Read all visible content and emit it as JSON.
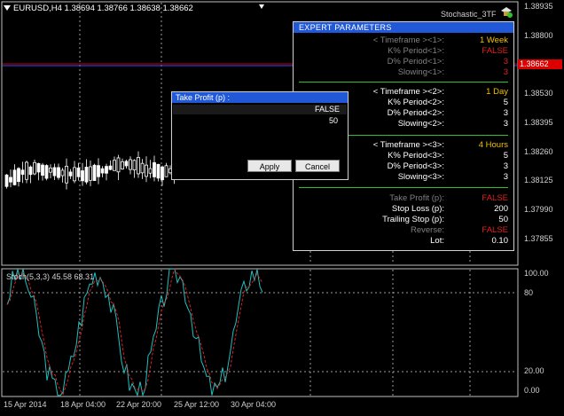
{
  "chart": {
    "symbol_info": "EURUSD,H4  1.38694 1.38766 1.38638 1.38662",
    "indicator_name": "Stochastic_3TF",
    "price_axis": [
      "1.38935",
      "1.38800",
      "1.38662",
      "1.38530",
      "1.38395",
      "1.38260",
      "1.38125",
      "1.37990",
      "1.37855"
    ],
    "current_price": "1.38662",
    "stoch_label": "Stoch(5,3,3) 45.58 68.31",
    "stoch_axis": [
      "100.00",
      "80",
      "20.00",
      "0.00"
    ],
    "dates": [
      "15 Apr 2014",
      "18 Apr 04:00",
      "22 Apr 20:00",
      "25 Apr 12:00",
      "30 Apr 04:00"
    ],
    "colors": {
      "main_line": "#20c0c0",
      "signal_line": "#e02020",
      "price_line": "#d00000",
      "grid": "#c0c0c0"
    }
  },
  "expert_panel": {
    "title": "EXPERT  PARAMETERS",
    "rows": [
      {
        "label": "< Timeframe ><1>:",
        "value": "1 Week",
        "label_color": "#808080",
        "value_color": "#f0c000"
      },
      {
        "label": "K% Period<1>:",
        "value": "FALSE",
        "label_color": "#808080",
        "value_color": "#e02020"
      },
      {
        "label": "D% Period<1>:",
        "value": "3",
        "label_color": "#808080",
        "value_color": "#e02020"
      },
      {
        "label": "Slowing<1>:",
        "value": "3",
        "label_color": "#808080",
        "value_color": "#e02020"
      },
      {
        "label": "< Timeframe ><2>:",
        "value": "1 Day",
        "label_color": "#ffffff",
        "value_color": "#f0c000"
      },
      {
        "label": "K% Period<2>:",
        "value": "5",
        "label_color": "#ffffff",
        "value_color": "#ffffff"
      },
      {
        "label": "D% Period<2>:",
        "value": "3",
        "label_color": "#ffffff",
        "value_color": "#ffffff"
      },
      {
        "label": "Slowing<2>:",
        "value": "3",
        "label_color": "#ffffff",
        "value_color": "#ffffff"
      },
      {
        "label": "< Timeframe ><3>:",
        "value": "4 Hours",
        "label_color": "#ffffff",
        "value_color": "#f0c000"
      },
      {
        "label": "K% Period<3>:",
        "value": "5",
        "label_color": "#ffffff",
        "value_color": "#ffffff"
      },
      {
        "label": "D% Period<3>:",
        "value": "3",
        "label_color": "#ffffff",
        "value_color": "#ffffff"
      },
      {
        "label": "Slowing<3>:",
        "value": "3",
        "label_color": "#ffffff",
        "value_color": "#ffffff"
      },
      {
        "label": "Take Profit (p):",
        "value": "FALSE",
        "label_color": "#808080",
        "value_color": "#e02020"
      },
      {
        "label": "Stop Loss (p):",
        "value": "200",
        "label_color": "#ffffff",
        "value_color": "#ffffff"
      },
      {
        "label": "Trailing Stop (p):",
        "value": "50",
        "label_color": "#ffffff",
        "value_color": "#ffffff"
      },
      {
        "label": "Reverse:",
        "value": "FALSE",
        "label_color": "#808080",
        "value_color": "#e02020"
      },
      {
        "label": "Lot:",
        "value": "0.10",
        "label_color": "#ffffff",
        "value_color": "#ffffff"
      }
    ]
  },
  "dialog": {
    "title": "Take Profit (p) :",
    "option": "FALSE",
    "value": "50",
    "apply_label": "Apply",
    "cancel_label": "Cancel"
  }
}
